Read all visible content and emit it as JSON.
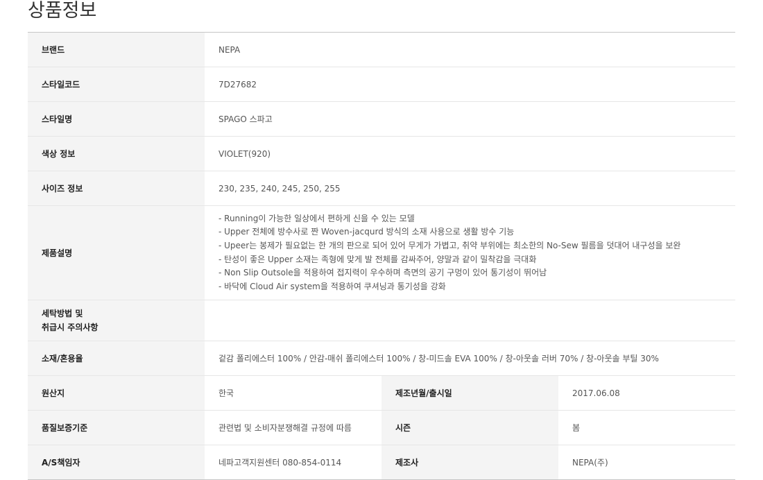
{
  "page_title": "상품정보",
  "rows": {
    "brand": {
      "label": "브랜드",
      "value": "NEPA"
    },
    "style_code": {
      "label": "스타일코드",
      "value": "7D27682"
    },
    "style_name": {
      "label": "스타일명",
      "value": "SPAGO 스파고"
    },
    "color": {
      "label": "색상 정보",
      "value": "VIOLET(920)"
    },
    "size": {
      "label": "사이즈 정보",
      "value": "230, 235, 240, 245, 250, 255"
    },
    "description": {
      "label": "제품설명",
      "lines": [
        "- Running이 가능한 일상에서 편하게 신을 수 있는 모델",
        "- Upper 전체에 방수사로 짠 Woven-jacqurd 방식의 소재 사용으로 생활 방수 기능",
        "- Upeer는 봉제가 필요없는 한 개의 판으로 되어 있어 무게가 가볍고, 취약 부위에는 최소한의 No-Sew 필름을 덧대어 내구성을 보완",
        "- 탄성이 좋은 Upper 소재는 족형에 맞게 발 전체를 감싸주어, 양말과 같이 밀착감을 극대화",
        "- Non Slip Outsole을 적용하여 접지력이 우수하며 측면의 공기 구멍이 있어 통기성이 뛰어남",
        "- 바닥에 Cloud Air system을 적용하여 쿠셔닝과 통기성을 강화"
      ]
    },
    "care": {
      "label_line1": "세탁방법 및",
      "label_line2": "취급시 주의사항",
      "value": ""
    },
    "material": {
      "label": "소재/혼용율",
      "value": "겉감 폴리에스터 100% / 안감-매쉬 폴리에스터 100% / 창-미드솔 EVA 100% / 창-아웃솔 러버 70% / 창-아웃솔 부틸 30%"
    },
    "origin": {
      "label": "원산지",
      "value": "한국"
    },
    "made_date": {
      "label": "제조년월/출시일",
      "value": "2017.06.08"
    },
    "quality": {
      "label": "품질보증기준",
      "value": "관련법 및 소비자분쟁해결 규정에 따름"
    },
    "season": {
      "label": "시즌",
      "value": "봄"
    },
    "as_manager": {
      "label": "A/S책임자",
      "value": "네파고객지원센터 080-854-0114"
    },
    "manufacturer": {
      "label": "제조사",
      "value": "NEPA(주)"
    }
  }
}
